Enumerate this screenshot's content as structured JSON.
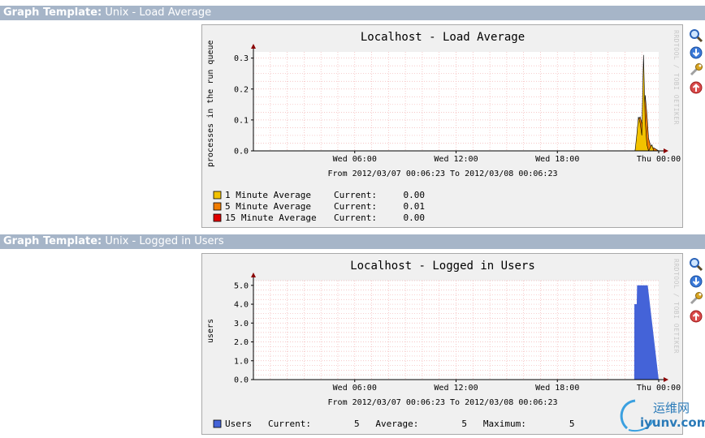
{
  "sections": [
    {
      "label_bold": "Graph Template:",
      "label_value": "Unix - Load Average",
      "graph": {
        "title": "Localhost - Load Average",
        "ylabel": "processes in the run queue",
        "date_range": "From 2012/03/07 00:06:23 To 2012/03/08 00:06:23",
        "side_text": "RRDTOOL / TOBI OETIKER",
        "legend": [
          {
            "name": "1 Minute Average",
            "stat_label": "Current:",
            "stat_value": "0.00",
            "color": "#f2c200"
          },
          {
            "name": "5 Minute Average",
            "stat_label": "Current:",
            "stat_value": "0.01",
            "color": "#f07c00"
          },
          {
            "name": "15 Minute Average",
            "stat_label": "Current:",
            "stat_value": "0.00",
            "color": "#e00000"
          }
        ]
      }
    },
    {
      "label_bold": "Graph Template:",
      "label_value": "Unix - Logged in Users",
      "graph": {
        "title": "Localhost - Logged in Users",
        "ylabel": "users",
        "date_range": "From 2012/03/07 00:06:23 To 2012/03/08 00:06:23",
        "side_text": "RRDTOOL / TOBI OETIKER",
        "legend": [
          {
            "name": "Users",
            "stats": "Current:        5   Average:        5   Maximum:        5",
            "color": "#4463d8"
          }
        ]
      }
    }
  ],
  "icons": [
    "zoom-icon",
    "download-icon",
    "properties-icon",
    "move-up-icon"
  ],
  "watermark": {
    "cn": "运维网",
    "en": "iyunv.com"
  },
  "chart_data": [
    {
      "type": "area",
      "title": "Localhost - Load Average",
      "ylabel": "processes in the run queue",
      "xlabel": "From 2012/03/07 00:06:23 To 2012/03/08 00:06:23",
      "x_ticks": [
        "Wed 06:00",
        "Wed 12:00",
        "Wed 18:00",
        "Thu 00:00"
      ],
      "y_ticks": [
        "0.0",
        "0.1",
        "0.2",
        "0.3"
      ],
      "ylim": [
        0,
        0.32
      ],
      "x_hours": [
        0,
        22.6,
        22.7,
        22.8,
        22.9,
        23.0,
        23.1,
        23.2,
        23.3,
        23.4,
        23.5,
        23.6,
        23.7,
        24.0
      ],
      "series": [
        {
          "name": "15 Minute Average",
          "color": "#e00000",
          "values": [
            0,
            0,
            0,
            0.01,
            0.02,
            0.03,
            0.03,
            0.03,
            0.03,
            0.02,
            0.01,
            0,
            0,
            0
          ]
        },
        {
          "name": "5 Minute Average",
          "color": "#f07c00",
          "values": [
            0,
            0,
            0.03,
            0.1,
            0.11,
            0.09,
            0.08,
            0.18,
            0.12,
            0.04,
            0.02,
            0.01,
            0.01,
            0
          ]
        },
        {
          "name": "1 Minute Average",
          "color": "#f2c200",
          "values": [
            0,
            0,
            0.05,
            0.11,
            0.09,
            0.05,
            0.31,
            0.1,
            0.02,
            0.0,
            0.01,
            0.02,
            0,
            0
          ]
        }
      ],
      "grid": true
    },
    {
      "type": "area",
      "title": "Localhost - Logged in Users",
      "ylabel": "users",
      "xlabel": "From 2012/03/07 00:06:23 To 2012/03/08 00:06:23",
      "x_ticks": [
        "Wed 06:00",
        "Wed 12:00",
        "Wed 18:00",
        "Thu 00:00"
      ],
      "y_ticks": [
        "0.0",
        "1.0",
        "2.0",
        "3.0",
        "4.0",
        "5.0"
      ],
      "ylim": [
        0,
        5.25
      ],
      "x_hours": [
        0,
        22.55,
        22.56,
        22.7,
        22.72,
        23.35,
        24.0
      ],
      "series": [
        {
          "name": "Users",
          "color": "#4463d8",
          "values": [
            0,
            0,
            4,
            4,
            5,
            5,
            0
          ]
        }
      ],
      "grid": true
    }
  ]
}
